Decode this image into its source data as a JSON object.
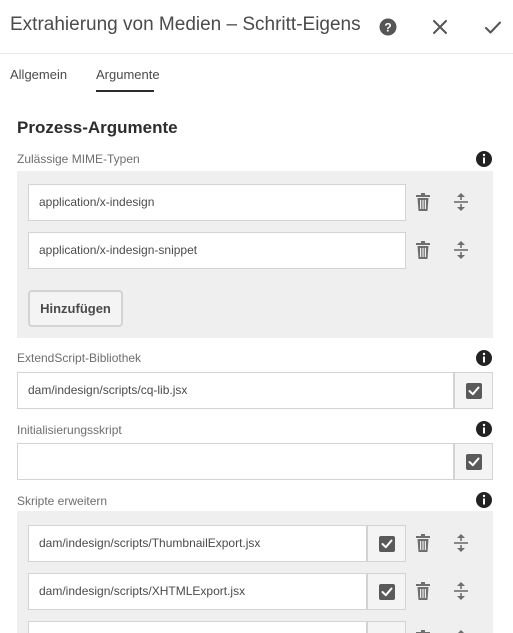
{
  "header": {
    "title": "Extrahierung von Medien – Schritt-Eigensc...",
    "help_icon": "help-circle-icon",
    "close_icon": "close-icon",
    "done_icon": "checkmark-icon"
  },
  "tabs": [
    {
      "label": "Allgemein"
    },
    {
      "label": "Argumente",
      "selected": true
    }
  ],
  "section": {
    "title": "Prozess-Argumente"
  },
  "mime": {
    "label": "Zulässige MIME-Typen",
    "items": [
      {
        "value": "application/x-indesign"
      },
      {
        "value": "application/x-indesign-snippet"
      }
    ],
    "add_label": "Hinzufügen"
  },
  "library": {
    "label": "ExtendScript-Bibliothek",
    "value": "dam/indesign/scripts/cq-lib.jsx"
  },
  "init_script": {
    "label": "Initialisierungsskript",
    "value": ""
  },
  "extend": {
    "label": "Skripte erweitern",
    "items": [
      {
        "value": "dam/indesign/scripts/ThumbnailExport.jsx"
      },
      {
        "value": "dam/indesign/scripts/XHTMLExport.jsx"
      },
      {
        "value": ""
      }
    ]
  },
  "colors": {
    "text": "#4b4b4b",
    "panel": "#efefef",
    "border": "#d3d3d3",
    "icon": "#6e6e6e"
  }
}
